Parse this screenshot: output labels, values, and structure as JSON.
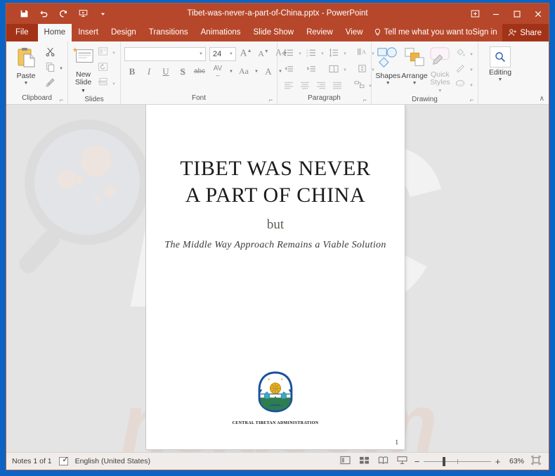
{
  "window": {
    "title": "Tibet-was-never-a-part-of-China.pptx - PowerPoint",
    "accent_color": "#b7472a",
    "file_tab_color": "#a33317",
    "desktop_color": "#0b64c4"
  },
  "quick_access": [
    {
      "name": "save-button",
      "icon": "save-icon",
      "tooltip": "Save"
    },
    {
      "name": "undo-button",
      "icon": "undo-icon",
      "tooltip": "Undo"
    },
    {
      "name": "redo-button",
      "icon": "redo-icon",
      "tooltip": "Redo"
    },
    {
      "name": "start-slideshow-button",
      "icon": "slideshow-icon",
      "tooltip": "Start From Beginning"
    },
    {
      "name": "customize-qat-button",
      "icon": "chevron-down-icon",
      "tooltip": "Customize Quick Access Toolbar"
    }
  ],
  "window_controls": [
    {
      "name": "ribbon-display-options-button",
      "icon": "ribbon-options-icon"
    },
    {
      "name": "minimize-button",
      "icon": "minimize-icon"
    },
    {
      "name": "maximize-button",
      "icon": "maximize-icon"
    },
    {
      "name": "close-button",
      "icon": "close-icon"
    }
  ],
  "tabs": {
    "file": "File",
    "items": [
      {
        "label": "Home",
        "active": true
      },
      {
        "label": "Insert",
        "active": false
      },
      {
        "label": "Design",
        "active": false
      },
      {
        "label": "Transitions",
        "active": false
      },
      {
        "label": "Animations",
        "active": false
      },
      {
        "label": "Slide Show",
        "active": false
      },
      {
        "label": "Review",
        "active": false
      },
      {
        "label": "View",
        "active": false
      }
    ],
    "tell_me": "Tell me what you want to ",
    "sign_in": "Sign in",
    "share": "Share"
  },
  "ribbon": {
    "groups": [
      {
        "label": "Clipboard"
      },
      {
        "label": "Slides"
      },
      {
        "label": "Font"
      },
      {
        "label": "Paragraph"
      },
      {
        "label": "Drawing"
      }
    ],
    "clipboard": {
      "paste_label": "Paste",
      "cut_tooltip": "Cut",
      "copy_tooltip": "Copy",
      "format_painter_tooltip": "Format Painter"
    },
    "slides": {
      "new_slide_label": "New\nSlide",
      "new_slide_line1": "New",
      "new_slide_line2": "Slide",
      "layout_tooltip": "Layout",
      "reset_tooltip": "Reset",
      "section_tooltip": "Section"
    },
    "font": {
      "font_name_value": "",
      "font_name_placeholder": "",
      "font_size_value": "24",
      "grow_font_tooltip": "Increase Font Size",
      "shrink_font_tooltip": "Decrease Font Size",
      "clear_formatting_tooltip": "Clear All Formatting",
      "bold": "B",
      "italic": "I",
      "underline": "U",
      "shadow": "S",
      "strikethrough": "abc",
      "character_spacing": "AV",
      "change_case": "Aa",
      "font_color": "A"
    },
    "paragraph": {
      "bullets_tooltip": "Bullets",
      "numbering_tooltip": "Numbering",
      "line_spacing_tooltip": "Line Spacing",
      "text_direction_tooltip": "Text Direction",
      "decrease_indent_tooltip": "Decrease List Level",
      "increase_indent_tooltip": "Increase List Level",
      "columns_tooltip": "Add or Remove Columns",
      "align_text_tooltip": "Align Text",
      "align_left_tooltip": "Align Left",
      "center_tooltip": "Center",
      "align_right_tooltip": "Align Right",
      "justify_tooltip": "Justify",
      "convert_smartart_tooltip": "Convert to SmartArt"
    },
    "drawing": {
      "shapes_label": "Shapes",
      "arrange_label": "Arrange",
      "quick_styles_line1": "Quick",
      "quick_styles_line2": "Styles",
      "shape_fill_tooltip": "Shape Fill",
      "shape_outline_tooltip": "Shape Outline",
      "shape_effects_tooltip": "Shape Effects"
    },
    "editing": {
      "label": "Editing",
      "icon": "search-icon"
    },
    "collapse_ribbon_icon": "chevron-up-icon"
  },
  "slide": {
    "title_line1": "TIBET WAS NEVER",
    "title_line2": "A PART OF CHINA",
    "connector": "but",
    "subtitle": "The Middle Way Approach Remains a Viable Solution",
    "emblem_caption": "CENTRAL TIBETAN ADMINISTRATION",
    "slide_number": "1",
    "emblem_colors": {
      "sky": "#1b4f9c",
      "ring": "#1b4f9c",
      "snow": "#ffffff",
      "wheel": "#e8b31f",
      "grass": "#2e7d4f",
      "lion": "#2f9fb5"
    }
  },
  "watermark": {
    "big_text": "PC",
    "bottom_text": "risk.com",
    "glass_icon": "magnifier-icon"
  },
  "status_bar": {
    "notes": "Notes 1 of 1",
    "language": "English (United States)",
    "spellcheck_icon": "spellcheck-icon",
    "views": [
      {
        "name": "normal-view-button",
        "icon": "normal-view-icon"
      },
      {
        "name": "slide-sorter-button",
        "icon": "slide-sorter-icon"
      },
      {
        "name": "reading-view-button",
        "icon": "reading-view-icon"
      },
      {
        "name": "slideshow-view-button",
        "icon": "slideshow-view-icon"
      }
    ],
    "zoom_out": "−",
    "zoom_in": "+",
    "zoom_value": "63%",
    "fit_slide_icon": "fit-to-window-icon"
  }
}
